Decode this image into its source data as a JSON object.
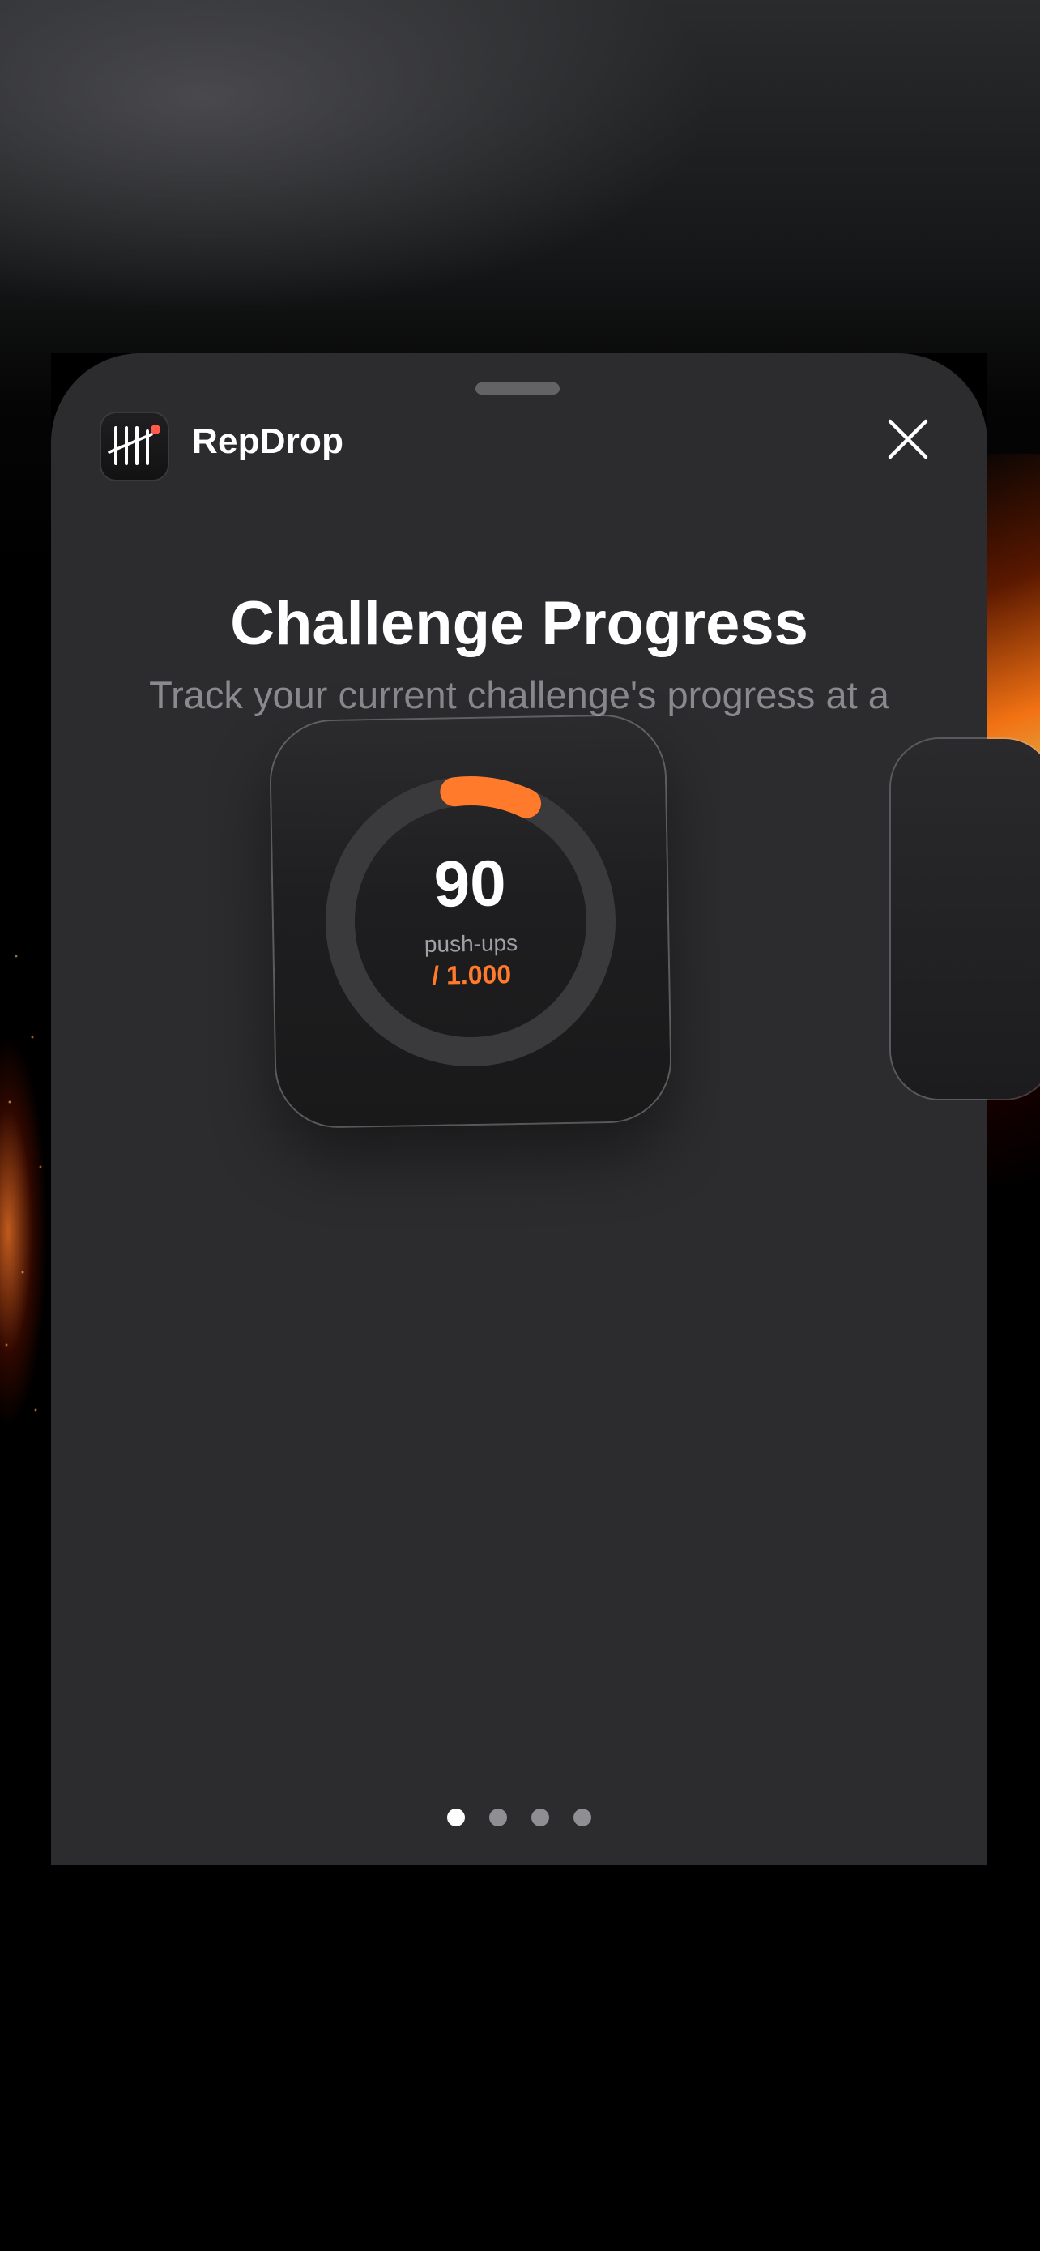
{
  "app": {
    "name": "RepDrop",
    "icon": "tally-marks-icon"
  },
  "header": {
    "close_icon": "close-icon"
  },
  "onboarding": {
    "title": "Challenge Progress",
    "subtitle": "Track your current challenge's progress at a glance."
  },
  "widget": {
    "value": "90",
    "unit": "push-ups",
    "goal": "/ 1.000",
    "progress": 0.09
  },
  "pagination": {
    "total": 4,
    "current": 1
  },
  "colors": {
    "accent": "#ff7a2a",
    "sheet_background": "#2c2c2e",
    "ring_track": "#3a3a3c"
  }
}
